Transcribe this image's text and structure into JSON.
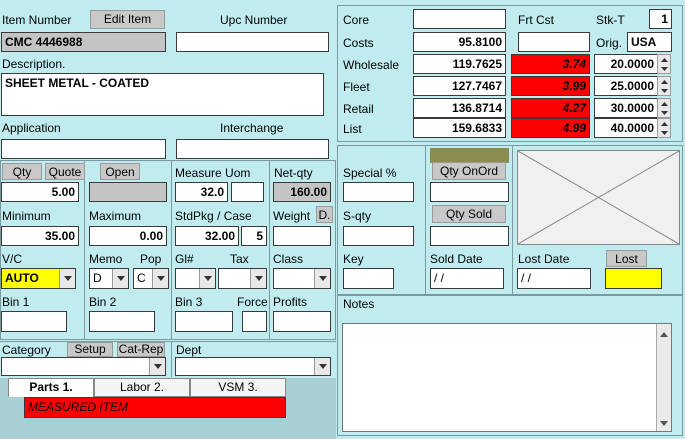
{
  "item": {
    "item_number_label": "Item Number",
    "edit_item_label": "Edit Item",
    "upc_label": "Upc  Number",
    "item_number": "CMC 4446988",
    "upc_number": "",
    "description_label": "Description.",
    "description": "SHEET METAL - COATED",
    "application_label": "Application",
    "interchange_label": "Interchange",
    "application": "",
    "interchange": ""
  },
  "pricing": {
    "core_label": "Core",
    "frt_cst_label": "Frt Cst",
    "stk_t_label": "Stk-T",
    "stk_t_value": "1",
    "orig_label": "Orig.",
    "orig_value": "USA",
    "core_value": "",
    "frt_cst_value": "",
    "rows": [
      {
        "label": "Costs",
        "value": "95.8100",
        "markup": "",
        "pct": ""
      },
      {
        "label": "Wholesale",
        "value": "119.7625",
        "markup": "3.74",
        "pct": "20.0000"
      },
      {
        "label": "Fleet",
        "value": "127.7467",
        "markup": "3.99",
        "pct": "25.0000"
      },
      {
        "label": "Retail",
        "value": "136.8714",
        "markup": "4.27",
        "pct": "30.0000"
      },
      {
        "label": "List",
        "value": "159.6833",
        "markup": "4.99",
        "pct": "40.0000"
      }
    ]
  },
  "qty": {
    "qty_label": "Qty",
    "quote_label": "Quote",
    "open_label": "Open",
    "qty_value": "5.00",
    "open_value": "",
    "minimum_label": "Minimum",
    "minimum_value": "35.00",
    "maximum_label": "Maximum",
    "maximum_value": "0.00",
    "vc_label": "V/C",
    "vc_value": "AUTO",
    "memo_label": "Memo",
    "memo_value": "D",
    "pop_label": "Pop",
    "pop_value": "C",
    "bin1_label": "Bin 1",
    "bin2_label": "Bin 2",
    "bin1_value": "",
    "bin2_value": ""
  },
  "measure": {
    "measure_uom_label": "Measure Uom",
    "measure_value": "32.0",
    "uom_value": "",
    "net_qty_label": "Net-qty",
    "net_qty_value": "160.00",
    "stdpkg_label": "StdPkg / Case",
    "stdpkg_value": "32.00",
    "case_value": "5",
    "weight_label": "Weight",
    "weight_btn": "D.",
    "weight_value": "",
    "gl_label": "Gl#",
    "tax_label": "Tax",
    "class_label": "Class",
    "bin3_label": "Bin 3",
    "force_label": "Force",
    "profits_label": "Profits",
    "bin3_value": "",
    "force_value": "",
    "profits_value": ""
  },
  "sales": {
    "special_label": "Special %",
    "qty_onord_label": "Qty OnOrd",
    "sqty_label": "S-qty",
    "qty_sold_label": "Qty Sold",
    "key_label": "Key",
    "sold_date_label": "Sold Date",
    "sold_date_value": " / /",
    "lost_date_label": "Lost Date",
    "lost_date_value": " / /",
    "lost_label": "Lost",
    "notes_label": "Notes",
    "special_value": "",
    "qty_onord_value": "",
    "sqty_value": "",
    "qty_sold_value": "",
    "key_value": ""
  },
  "bottom": {
    "category_label": "Category",
    "setup_label": "Setup",
    "cat_rep_label": "Cat-Rep",
    "dept_label": "Dept",
    "category_value": "",
    "dept_value": "",
    "tabs": [
      "Parts 1.",
      "Labor 2.",
      "VSM 3."
    ],
    "status": "MEASURED ITEM"
  },
  "colors": {
    "background": "#c0ecf0",
    "alert_red": "#ff0000",
    "highlight_yellow": "#ffff00"
  }
}
